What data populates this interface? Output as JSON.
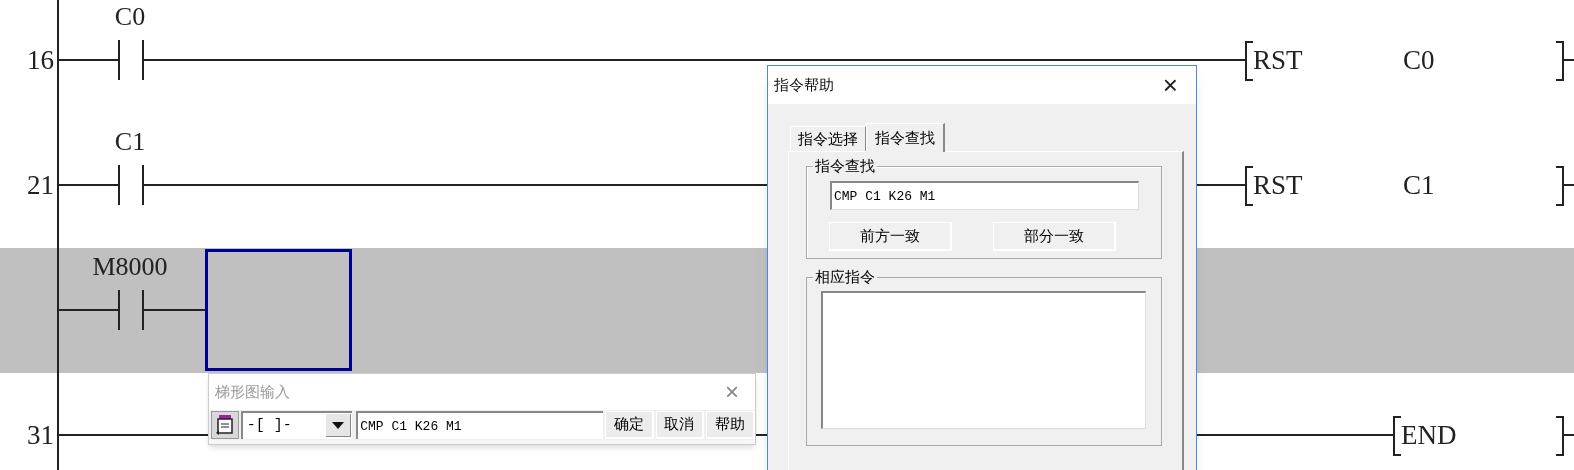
{
  "ladder": {
    "rungs": [
      {
        "step": "16",
        "selected": false,
        "cursor": false,
        "contacts": [
          {
            "label": "C0"
          }
        ],
        "instruction": {
          "kind": "box",
          "operator": "RST",
          "operand": "C0"
        }
      },
      {
        "step": "21",
        "selected": false,
        "cursor": false,
        "contacts": [
          {
            "label": "C1"
          }
        ],
        "instruction": {
          "kind": "box",
          "operator": "RST",
          "operand": "C1"
        }
      },
      {
        "selected": true,
        "cursor": true,
        "contacts": [
          {
            "label": "M8000"
          }
        ]
      },
      {
        "step": "31",
        "selected": false,
        "cursor": false,
        "instruction": {
          "kind": "end",
          "operator": "END"
        }
      }
    ]
  },
  "help_dialog": {
    "title": "指令帮助",
    "close": "×",
    "tabs": [
      {
        "label": "指令选择",
        "selected": false
      },
      {
        "label": "指令查找",
        "selected": true
      }
    ],
    "search_group": {
      "title": "指令查找",
      "value": "CMP C1 K26 M1",
      "buttons": [
        "前方一致",
        "部分一致"
      ]
    },
    "results_group": {
      "title": "相应指令"
    }
  },
  "input_dialog": {
    "title": "梯形图输入",
    "close": "×",
    "element": "-[ ]-",
    "value": "CMP C1 K26 M1",
    "buttons": [
      "确定",
      "取消",
      "帮助"
    ]
  }
}
